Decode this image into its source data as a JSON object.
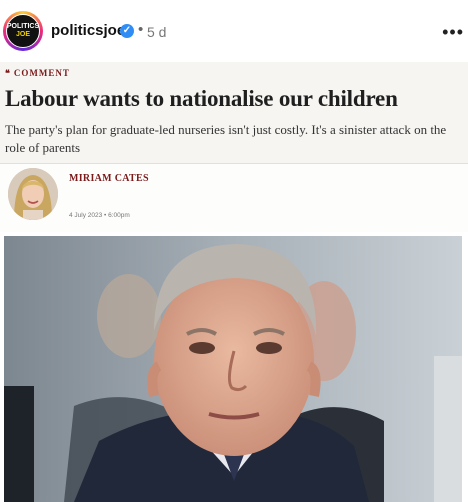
{
  "post": {
    "avatar_text_top": "POLITICS",
    "avatar_text_bottom": "JOE",
    "username": "politicsjoe",
    "verified_mark": "✓",
    "separator": "•",
    "time_ago": "5 d",
    "more_label": "•••"
  },
  "article": {
    "section_icon": "❝",
    "section": "COMMENT",
    "headline": "Labour wants to nationalise our children",
    "standfirst": "The party's plan for graduate-led nurseries isn't just costly. It's a sinister attack on the role of parents",
    "author": "MIRIAM CATES",
    "date": "4 July 2023 • 6:00pm"
  },
  "icons": {
    "verified": "verified-badge-icon",
    "more": "more-options-icon"
  },
  "colors": {
    "accent": "#7b1a1a",
    "verified": "#2f8df5",
    "header_bg": "#f6f5f2"
  }
}
